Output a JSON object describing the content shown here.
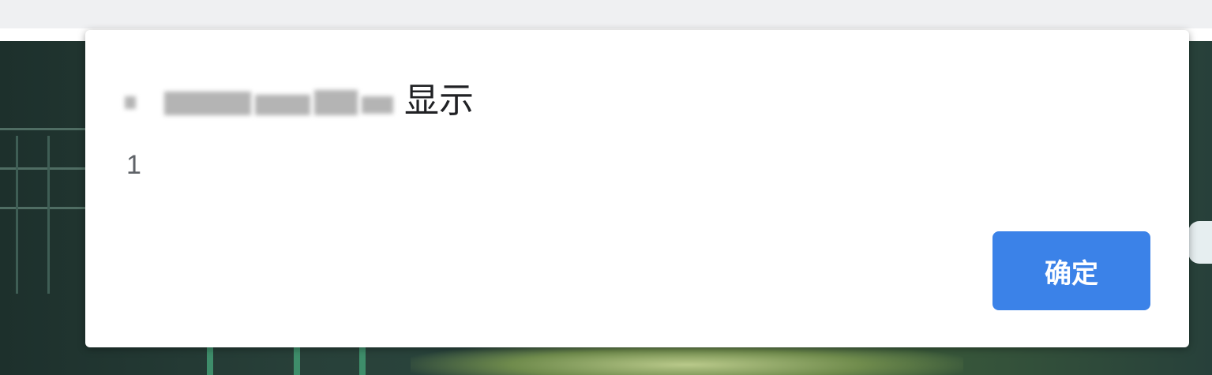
{
  "dialog": {
    "origin_suffix": "显示",
    "message": "1",
    "ok_label": "确定"
  },
  "colors": {
    "ok_button": "#3b82e8",
    "browser_strip": "#eff0f2",
    "dialog_background": "#ffffff"
  }
}
